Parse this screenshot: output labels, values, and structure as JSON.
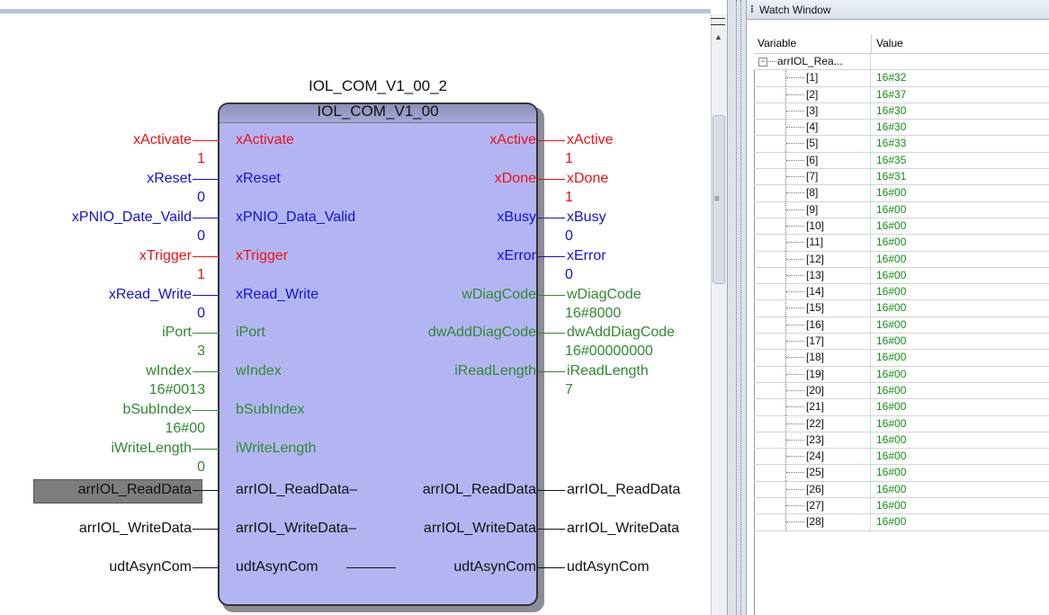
{
  "fb": {
    "instance_name": "IOL_COM_V1_00_2",
    "type_name": "IOL_COM_V1_00",
    "inputs": [
      {
        "ext": "xActivate",
        "pin": "xActivate",
        "value": "1",
        "color": "#ee1111"
      },
      {
        "ext": "xReset",
        "pin": "xReset",
        "value": "0",
        "color": "#1010e0"
      },
      {
        "ext": "xPNIO_Date_Vaild",
        "pin": "xPNIO_Data_Valid",
        "value": "0",
        "color": "#1010e0"
      },
      {
        "ext": "xTrigger",
        "pin": "xTrigger",
        "value": "1",
        "color": "#ee1111"
      },
      {
        "ext": "xRead_Write",
        "pin": "xRead_Write",
        "value": "0",
        "color": "#1010e0"
      },
      {
        "ext": "iPort",
        "pin": "iPort",
        "value": "3",
        "color": "#2f8a2f"
      },
      {
        "ext": "wIndex",
        "pin": "wIndex",
        "value": "16#0013",
        "color": "#2f8a2f"
      },
      {
        "ext": "bSubIndex",
        "pin": "bSubIndex",
        "value": "16#00",
        "color": "#2f8a2f"
      },
      {
        "ext": "iWriteLength",
        "pin": "iWriteLength",
        "value": "0",
        "color": "#2f8a2f"
      }
    ],
    "outputs": [
      {
        "pin": "xActive",
        "ext": "xActive",
        "value": "1",
        "color": "#ee1111"
      },
      {
        "pin": "xDone",
        "ext": "xDone",
        "value": "1",
        "color": "#ee1111"
      },
      {
        "pin": "xBusy",
        "ext": "xBusy",
        "value": "0",
        "color": "#1010e0"
      },
      {
        "pin": "xError",
        "ext": "xError",
        "value": "0",
        "color": "#1010e0"
      },
      {
        "pin": "wDiagCode",
        "ext": "wDiagCode",
        "value": "16#8000",
        "color": "#2f8a2f"
      },
      {
        "pin": "dwAddDiagCode",
        "ext": "dwAddDiagCode",
        "value": "16#00000000",
        "color": "#2f8a2f"
      },
      {
        "pin": "iReadLength",
        "ext": "iReadLength",
        "value": "7",
        "color": "#2f8a2f"
      }
    ],
    "inouts": [
      {
        "ext_in": "arrIOL_ReadData",
        "pin_in": "arrIOL_ReadData",
        "pin_out": "arrIOL_ReadData",
        "ext_out": "arrIOL_ReadData"
      },
      {
        "ext_in": "arrIOL_WriteData",
        "pin_in": "arrIOL_WriteData",
        "pin_out": "arrIOL_WriteData",
        "ext_out": "arrIOL_WriteData"
      },
      {
        "ext_in": "udtAsynCom",
        "pin_in": "udtAsynCom",
        "pin_out": "udtAsynCom",
        "ext_out": "udtAsynCom"
      }
    ]
  },
  "watch": {
    "title": "Watch Window",
    "col_variable": "Variable",
    "col_value": "Value",
    "root": "arrIOL_Rea...",
    "expander": "−",
    "rows": [
      {
        "idx": "[1]",
        "val": "16#32"
      },
      {
        "idx": "[2]",
        "val": "16#37"
      },
      {
        "idx": "[3]",
        "val": "16#30"
      },
      {
        "idx": "[4]",
        "val": "16#30"
      },
      {
        "idx": "[5]",
        "val": "16#33"
      },
      {
        "idx": "[6]",
        "val": "16#35"
      },
      {
        "idx": "[7]",
        "val": "16#31"
      },
      {
        "idx": "[8]",
        "val": "16#00"
      },
      {
        "idx": "[9]",
        "val": "16#00"
      },
      {
        "idx": "[10]",
        "val": "16#00"
      },
      {
        "idx": "[11]",
        "val": "16#00"
      },
      {
        "idx": "[12]",
        "val": "16#00"
      },
      {
        "idx": "[13]",
        "val": "16#00"
      },
      {
        "idx": "[14]",
        "val": "16#00"
      },
      {
        "idx": "[15]",
        "val": "16#00"
      },
      {
        "idx": "[16]",
        "val": "16#00"
      },
      {
        "idx": "[17]",
        "val": "16#00"
      },
      {
        "idx": "[18]",
        "val": "16#00"
      },
      {
        "idx": "[19]",
        "val": "16#00"
      },
      {
        "idx": "[20]",
        "val": "16#00"
      },
      {
        "idx": "[21]",
        "val": "16#00"
      },
      {
        "idx": "[22]",
        "val": "16#00"
      },
      {
        "idx": "[23]",
        "val": "16#00"
      },
      {
        "idx": "[24]",
        "val": "16#00"
      },
      {
        "idx": "[25]",
        "val": "16#00"
      },
      {
        "idx": "[26]",
        "val": "16#00"
      },
      {
        "idx": "[27]",
        "val": "16#00"
      },
      {
        "idx": "[28]",
        "val": "16#00"
      }
    ]
  },
  "scroll": {
    "up_arrow": "▲",
    "grip": "≡"
  }
}
